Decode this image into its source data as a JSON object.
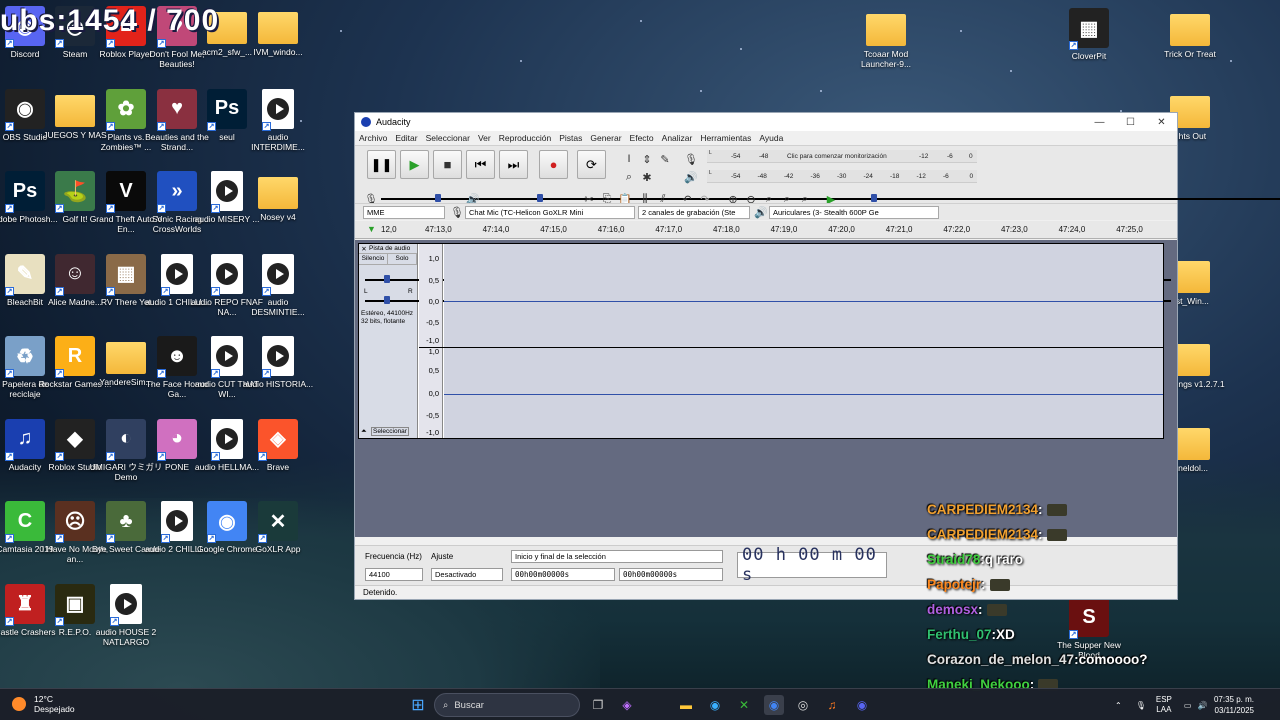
{
  "overlay": {
    "counter": "ubs:1454 / 700"
  },
  "desktop_icons": [
    {
      "label": "Discord",
      "kind": "app",
      "color": "#5865f2",
      "glyph": "◉"
    },
    {
      "label": "Steam",
      "kind": "app",
      "color": "#1b2838",
      "glyph": "◎"
    },
    {
      "label": "Roblox Player",
      "kind": "app",
      "color": "#e2231a",
      "glyph": "■"
    },
    {
      "label": "Don't Fool Me, Beauties!",
      "kind": "app",
      "color": "#c04878",
      "glyph": "♥"
    },
    {
      "label": "acm2_sfw_...",
      "kind": "folder"
    },
    {
      "label": "IVM_windo...",
      "kind": "folder"
    },
    {
      "label": "OBS Studio",
      "kind": "app",
      "color": "#222",
      "glyph": "◉"
    },
    {
      "label": "JUEGOS Y MAS",
      "kind": "folder"
    },
    {
      "label": "Plants vs. Zombies™ ...",
      "kind": "app",
      "color": "#5fa03a",
      "glyph": "✿"
    },
    {
      "label": "Beauties and the Strand...",
      "kind": "app",
      "color": "#8a3040",
      "glyph": "♥"
    },
    {
      "label": "seul",
      "kind": "app",
      "color": "#001e36",
      "glyph": "Ps"
    },
    {
      "label": "audio INTERDIME...",
      "kind": "audio"
    },
    {
      "label": "Adobe Photosh...",
      "kind": "app",
      "color": "#001e36",
      "glyph": "Ps"
    },
    {
      "label": "Golf It!",
      "kind": "app",
      "color": "#3a7a4a",
      "glyph": "⛳"
    },
    {
      "label": "Grand Theft Auto V En...",
      "kind": "app",
      "color": "#0a0a0a",
      "glyph": "V"
    },
    {
      "label": "Sonic Racing CrossWorlds",
      "kind": "app",
      "color": "#2050c0",
      "glyph": "»"
    },
    {
      "label": "audio MISERY ...",
      "kind": "audio"
    },
    {
      "label": "Nosey v4",
      "kind": "folder"
    },
    {
      "label": "BleachBit",
      "kind": "app",
      "color": "#e8e0c0",
      "glyph": "✎"
    },
    {
      "label": "Alice Madne...",
      "kind": "app",
      "color": "#402830",
      "glyph": "☺"
    },
    {
      "label": "RV There Yet",
      "kind": "app",
      "color": "#8a6a48",
      "glyph": "▦"
    },
    {
      "label": "audio 1 CHILLI...",
      "kind": "audio"
    },
    {
      "label": "audio REPO FNAF NA...",
      "kind": "audio"
    },
    {
      "label": "audio DESMINTIE...",
      "kind": "audio"
    },
    {
      "label": "Papelera de reciclaje",
      "kind": "app",
      "color": "#7aa0c8",
      "glyph": "♻"
    },
    {
      "label": "Rockstar Games ...",
      "kind": "app",
      "color": "#fcaf17",
      "glyph": "R"
    },
    {
      "label": "YanderеSim...",
      "kind": "folder"
    },
    {
      "label": "The Face Horror Ga...",
      "kind": "app",
      "color": "#1a1a1a",
      "glyph": "☻"
    },
    {
      "label": "audio CUT THAT WI...",
      "kind": "audio"
    },
    {
      "label": "audio HISTORIA...",
      "kind": "audio"
    },
    {
      "label": "Audacity",
      "kind": "app",
      "color": "#1a3fb0",
      "glyph": "♫"
    },
    {
      "label": "Roblox Studio",
      "kind": "app",
      "color": "#222",
      "glyph": "◆"
    },
    {
      "label": "UMIGARI ウミガリ Demo",
      "kind": "app",
      "color": "#304060",
      "glyph": "◐"
    },
    {
      "label": "PONE",
      "kind": "app",
      "color": "#d070c0",
      "glyph": "◕"
    },
    {
      "label": "audio HELLMA...",
      "kind": "audio"
    },
    {
      "label": "Brave",
      "kind": "app",
      "color": "#fb542b",
      "glyph": "◈"
    },
    {
      "label": "Camtasia 2019",
      "kind": "app",
      "color": "#3aba3a",
      "glyph": "C"
    },
    {
      "label": "I Have No Mouth, an...",
      "kind": "app",
      "color": "#5a3020",
      "glyph": "☹"
    },
    {
      "label": "Bye Sweet Carole",
      "kind": "app",
      "color": "#4a6a3a",
      "glyph": "♣"
    },
    {
      "label": "audio 2 CHILLI...",
      "kind": "audio"
    },
    {
      "label": "Google Chrome",
      "kind": "app",
      "color": "#4285f4",
      "glyph": "◉"
    },
    {
      "label": "GoXLR App",
      "kind": "app",
      "color": "#1a3a3a",
      "glyph": "✕"
    },
    {
      "label": "Castle Crashers",
      "kind": "app",
      "color": "#c02020",
      "glyph": "♜"
    },
    {
      "label": "R.E.P.O.",
      "kind": "app",
      "color": "#2a2a10",
      "glyph": "▣"
    },
    {
      "label": "audio HOUSE 2 NATLARGO",
      "kind": "audio"
    }
  ],
  "right_icons": [
    {
      "label": "Tcoaar Mod Launcher-9...",
      "kind": "folder"
    },
    {
      "label": "CloverPit",
      "kind": "app",
      "color": "#222",
      "glyph": "▦"
    },
    {
      "label": "Trick Or Treat",
      "kind": "folder"
    },
    {
      "label": "ghts Out",
      "kind": "folder"
    },
    {
      "label": "ust_Win...",
      "kind": "folder"
    },
    {
      "label": "ay Things v1.2.7.1",
      "kind": "folder"
    },
    {
      "label": "flineldol...",
      "kind": "folder"
    },
    {
      "label": "The Supper New Blood",
      "kind": "app",
      "color": "#6a1010",
      "glyph": "S"
    }
  ],
  "audacity": {
    "title": "Audacity",
    "menu": [
      "Archivo",
      "Editar",
      "Seleccionar",
      "Ver",
      "Reproducción",
      "Pistas",
      "Generar",
      "Efecto",
      "Analizar",
      "Herramientas",
      "Ayuda"
    ],
    "monitor_text": "Clic para comenzar monitorización",
    "meter_ticks_top": [
      "-54",
      "-48",
      "-12",
      "-6",
      "0"
    ],
    "meter_ticks_bottom": [
      "-54",
      "-48",
      "-42",
      "-36",
      "-30",
      "-24",
      "-18",
      "-12",
      "-6",
      "0"
    ],
    "host": "MME",
    "rec_device": "Chat Mic (TC-Helicon GoXLR Mini",
    "rec_channels": "2 canales de grabación (Ste",
    "play_device": "Auriculares (3- Stealth 600P Ge",
    "timeline_ticks": [
      "12,0",
      "47:13,0",
      "47:14,0",
      "47:15,0",
      "47:16,0",
      "47:17,0",
      "47:18,0",
      "47:19,0",
      "47:20,0",
      "47:21,0",
      "47:22,0",
      "47:23,0",
      "47:24,0",
      "47:25,0"
    ],
    "track": {
      "name": "Pista de audio",
      "mute": "Silencio",
      "solo": "Solo",
      "pan_l": "L",
      "pan_r": "R",
      "info": "Estéreo, 44100Hz",
      "info2": "32 bits, flotante",
      "select": "Seleccionar",
      "scale": [
        "1,0",
        "0,5",
        "0,0",
        "-0,5",
        "-1,0"
      ]
    },
    "selection": {
      "rate_label": "Frecuencia (Hz)",
      "rate_value": "44100",
      "snap_label": "Ajuste",
      "snap_value": "Desactivado",
      "mode": "Inicio y final de la selección",
      "start": "00h00m00000s",
      "end": "00h00m00000s",
      "time": "00 h 00 m 00 s"
    },
    "status": "Detenido."
  },
  "chat": [
    {
      "user": "CARPEDIEM2134",
      "color": "#f0a030",
      "msg": ""
    },
    {
      "user": "CARPEDIEM2134",
      "color": "#f0a030",
      "msg": ""
    },
    {
      "user": "Straid78",
      "color": "#40d040",
      "msg": "q raro"
    },
    {
      "user": "Papotejr",
      "color": "#ff8a20",
      "msg": ""
    },
    {
      "user": "demosx",
      "color": "#b060e0",
      "msg": ""
    },
    {
      "user": "Ferthu_07",
      "color": "#30c070",
      "msg": "XD"
    },
    {
      "user": "Corazon_de_melon_47",
      "color": "#e0e0e0",
      "msg": "comoooo?"
    },
    {
      "user": "Maneki_Nekooo",
      "color": "#40d040",
      "msg": ""
    }
  ],
  "taskbar": {
    "temp": "12°C",
    "weather": "Despejado",
    "search": "Buscar",
    "lang": "ESP",
    "lang2": "LAA",
    "time": "07:35 p. m.",
    "date": "03/11/2025"
  }
}
